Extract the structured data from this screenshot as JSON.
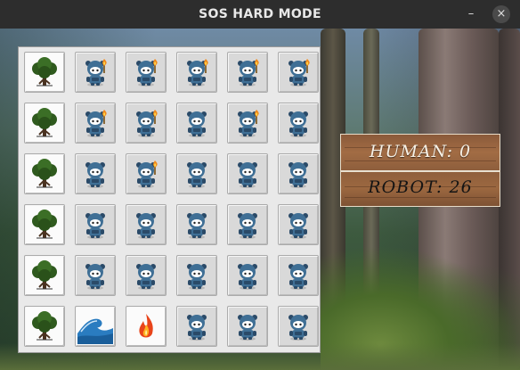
{
  "window": {
    "title": "SOS HARD MODE",
    "minimize_glyph": "–",
    "close_glyph": "×"
  },
  "board": {
    "rows": 6,
    "cols": 6,
    "cells": [
      [
        "tree",
        "robot-torch",
        "robot-torch",
        "robot-torch",
        "robot-torch",
        "robot-torch"
      ],
      [
        "tree",
        "robot-torch",
        "robot-torch",
        "robot",
        "robot-torch",
        "robot"
      ],
      [
        "tree",
        "robot",
        "robot-torch",
        "robot",
        "robot",
        "robot"
      ],
      [
        "tree",
        "robot",
        "robot",
        "robot",
        "robot",
        "robot"
      ],
      [
        "tree",
        "robot",
        "robot",
        "robot",
        "robot",
        "robot"
      ],
      [
        "tree",
        "wave",
        "fire",
        "robot",
        "robot",
        "robot"
      ]
    ]
  },
  "scores": {
    "human_label": "HUMAN: 0",
    "robot_label": "ROBOT: 26"
  },
  "colors": {
    "robot_body": "#3f6f95",
    "robot_dark": "#2a4a68",
    "tree_leaves": "#2f5a1e",
    "wave": "#2a7cc0",
    "fire": "#e8441a"
  }
}
